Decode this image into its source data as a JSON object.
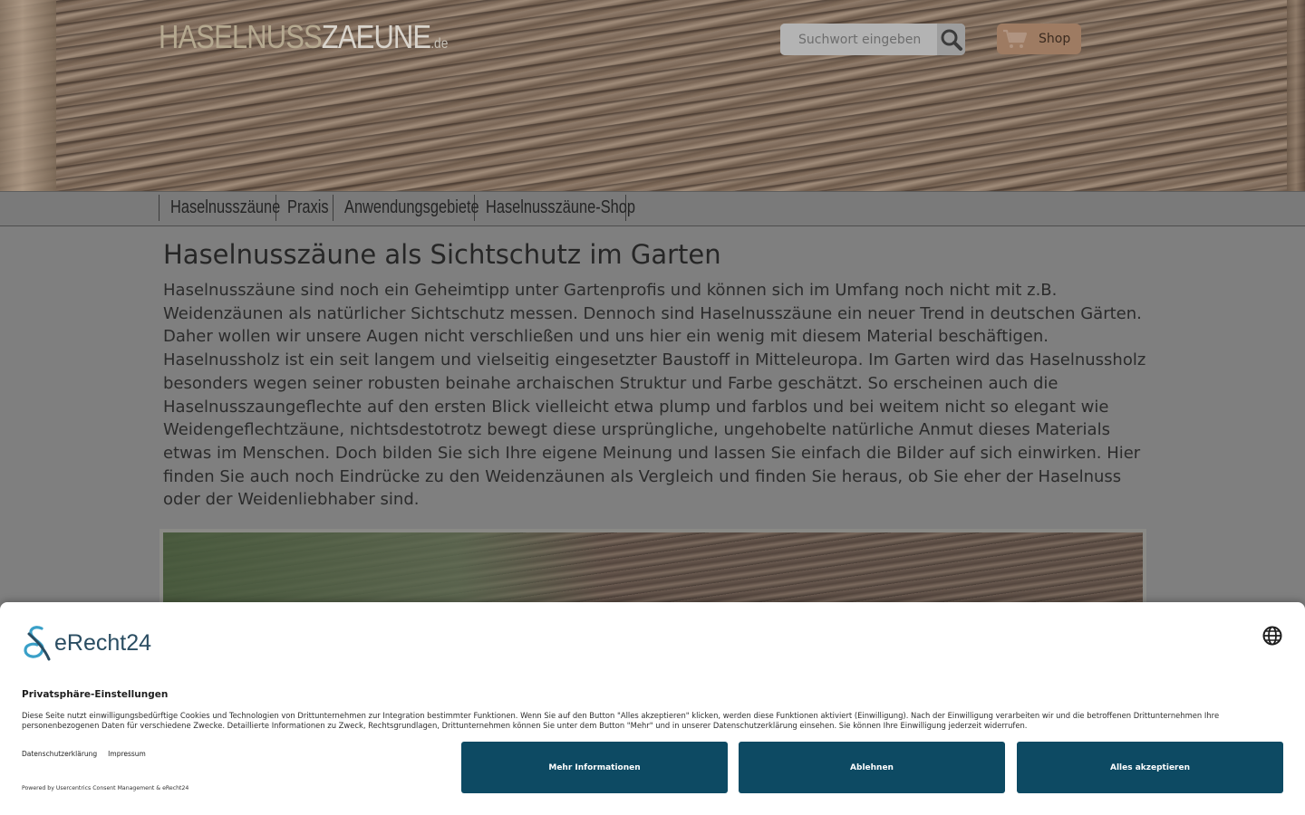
{
  "header": {
    "logo": {
      "part1": "HASELNUSS",
      "part2": "ZAEUNE",
      "tld": ".de"
    },
    "search": {
      "placeholder": "Suchwort eingeben"
    },
    "shop_label": "Shop"
  },
  "nav": {
    "items": [
      {
        "label": "Haselnusszäune"
      },
      {
        "label": "Praxis"
      },
      {
        "label": "Anwendungsgebiete"
      },
      {
        "label": "Haselnusszäune-Shop"
      }
    ]
  },
  "main": {
    "title": "Haselnusszäune als Sichtschutz im Garten",
    "paragraph": "Haselnusszäune sind noch ein Geheimtipp unter Gartenprofis und können sich im Umfang noch nicht mit z.B. Weidenzäunen als natürlicher Sichtschutz messen. Dennoch sind Haselnusszäune ein neuer Trend in deutschen Gärten. Daher wollen wir unsere Augen nicht verschließen und uns hier ein wenig mit diesem Material beschäftigen. Haselnussholz ist ein seit langem und vielseitig eingesetzter Baustoff in Mitteleuropa. Im Garten wird das Haselnussholz besonders wegen seiner robusten beinahe archaischen Struktur und Farbe geschätzt. So erscheinen auch die Haselnusszaungeflechte auf den ersten Blick vielleicht etwa plump und farblos und bei weitem nicht so elegant wie Weidengeflechtzäune, nichtsdestotrotz bewegt diese ursprüngliche, ungehobelte natürliche Anmut dieses Materials etwas im Menschen. Doch bilden Sie sich Ihre eigene Meinung und lassen Sie einfach die Bilder auf sich einwirken. Hier finden Sie auch noch Eindrücke zu den Weidenzäunen als Vergleich und finden Sie heraus, ob Sie eher der Haselnuss oder der Weidenliebhaber sind."
  },
  "cookie_banner": {
    "brand": "eRecht24",
    "title": "Privatsphäre-Einstellungen",
    "description": "Diese Seite nutzt einwilligungsbedürftige Cookies und Technologien von Drittunternehmen zur Integration bestimmter Funktionen. Wenn Sie auf den Button \"Alles akzeptieren\" klicken, werden diese Funktionen aktiviert (Einwilligung). Nach der Einwilligung verarbeiten wir und die betroffenen Drittunternehmen Ihre personenbezogenen Daten für verschiedene Zwecke. Detaillierte Informationen zu Zweck, Rechtsgrundlagen, Drittunternehmen können Sie unter dem Button \"Mehr\" und in unserer Datenschutzerklärung einsehen. Sie können Ihre Einwilligung jederzeit widerrufen.",
    "links": {
      "privacy": "Datenschutzerklärung",
      "imprint": "Impressum"
    },
    "powered_by": "Powered by Usercentrics Consent Management & eRecht24",
    "buttons": {
      "more": "Mehr Informationen",
      "deny": "Ablehnen",
      "accept": "Alles akzeptieren"
    }
  },
  "colors": {
    "accent": "#0d4a63",
    "brand_text": "#2a4d62",
    "shop_button": "#9e7b62"
  }
}
